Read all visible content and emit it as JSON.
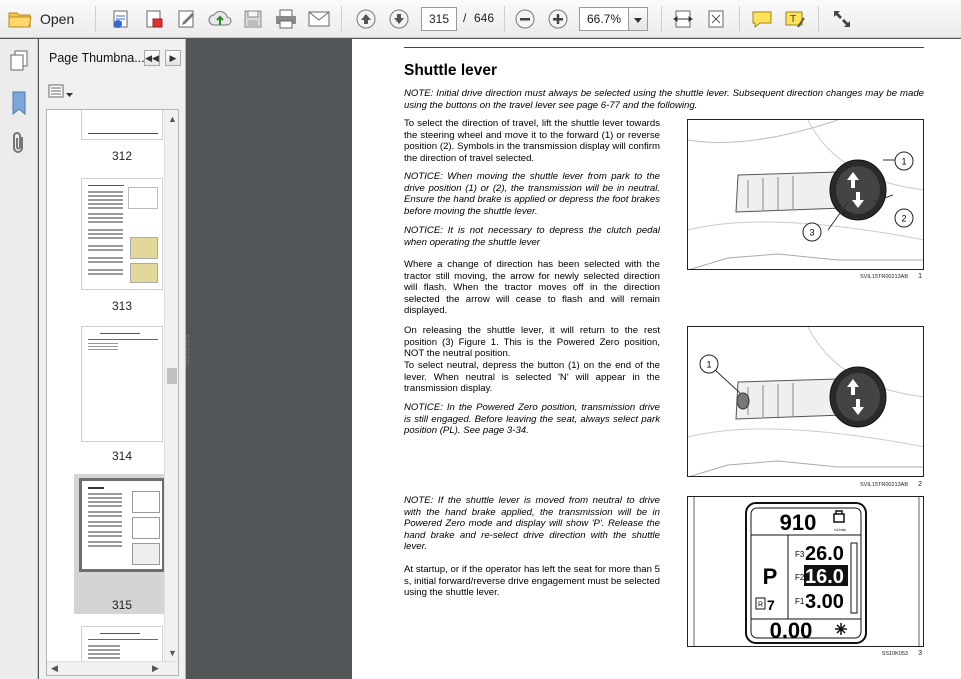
{
  "toolbar": {
    "open_label": "Open",
    "page_current": "315",
    "page_separator": "/",
    "page_total": "646",
    "zoom": "66.7%"
  },
  "sidebar": {
    "panel_title": "Page Thumbna...",
    "thumbnails": [
      {
        "number": "312"
      },
      {
        "number": "313"
      },
      {
        "number": "314"
      },
      {
        "number": "315",
        "selected": true
      }
    ]
  },
  "document": {
    "title": "Shuttle lever",
    "note_intro": "NOTE: Initial drive direction must always be selected using the shuttle lever. Subsequent direction changes may be made using the buttons on the travel lever see page 6-77 and the following.",
    "para1": "To select the direction of travel, lift the shuttle lever towards the steering wheel and move it to the forward (1) or reverse position (2). Symbols in the transmission display will confirm the direction of travel selected.",
    "notice1": "NOTICE: When moving the shuttle lever from park to the drive position (1) or (2), the transmission will be in neutral. Ensure the hand brake is applied or depress the foot brakes before moving the shuttle lever.",
    "notice2": "NOTICE: It is not necessary to depress the clutch pedal when operating the shuttle lever",
    "para2": "Where a change of direction has been selected with the tractor still moving, the arrow for newly selected direction will flash. When the tractor moves off in the direction selected the arrow will cease to flash and will remain displayed.",
    "para3": "On releasing the shuttle lever, it will return to the rest position (3) Figure 1. This is the Powered Zero position, NOT the neutral position.",
    "para4": "To select neutral, depress the button (1) on the end of the lever. When neutral is selected 'N' will appear in the transmission display.",
    "notice3": "NOTICE: In the Powered Zero position, transmission drive is still engaged. Before leaving the seat, always select park position (PL). See page 3-34.",
    "note2": "NOTE: If the shuttle lever is moved from neutral to drive with the hand brake applied, the transmission will be in Powered Zero mode and display will show 'P'. Release the hand brake and re-select drive direction with the shuttle lever.",
    "para5": "At startup, or if the operator has left the seat for more than 5 s, initial forward/reverse drive engagement must be selected using the shuttle lever."
  },
  "figures": [
    {
      "code": "SVIL15TR00213AB",
      "number": "1",
      "callouts": [
        "1",
        "2",
        "3"
      ]
    },
    {
      "code": "SVIL15TR00213AB",
      "number": "2",
      "callouts": [
        "1"
      ]
    },
    {
      "code": "SS10K053",
      "number": "3",
      "display": {
        "rpm": "910",
        "mode": "P",
        "gear_f3": "F3",
        "speed_f3": "26.0",
        "gear_f2": "F2",
        "speed_f2": "16.0",
        "gear_f1": "F1",
        "speed_f1": "3.00",
        "range_label": "R",
        "range_value": "7",
        "speed": "0.00",
        "rpm_unit": "x1/min"
      }
    }
  ]
}
